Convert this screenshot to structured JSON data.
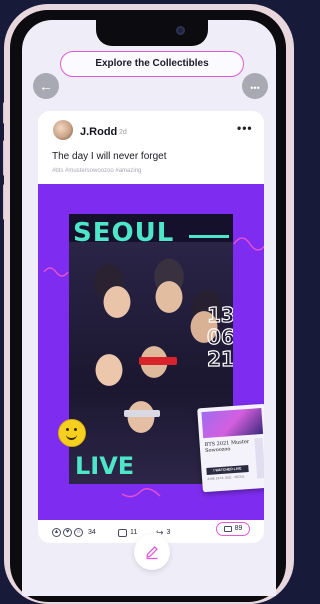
{
  "explore_button": {
    "label": "Explore the Collectibles"
  },
  "nav": {
    "back_icon": "arrow-left-icon",
    "more_icon": "more-horizontal-icon"
  },
  "post": {
    "author": "J.Rodd",
    "age": "2d",
    "menu": "•••",
    "caption": "The day I will never forget",
    "tags": "#bts #mustersowoozoo #amazing",
    "media": {
      "poster_headline": "SEOUL",
      "poster_footer": "LIVE",
      "poster_numbers": [
        "13",
        "06",
        "21"
      ],
      "ticket": {
        "title": "BTS 2021 Muster Sowoozoo",
        "badge": "I WATCHED LIVE",
        "subtitle": "JUNE 13-14, 2021 · SEOUL"
      }
    },
    "reactions": {
      "count": "34",
      "icons": [
        "thumbs-up-icon",
        "heart-icon",
        "fire-icon"
      ]
    },
    "comments": {
      "count": "11",
      "icon": "comment-icon"
    },
    "shares": {
      "count": "3",
      "icon": "share-icon"
    },
    "collect": {
      "count": "89",
      "icon": "collectible-icon"
    }
  },
  "fab": {
    "icon": "edit-pencil-icon"
  },
  "colors": {
    "accent": "#e05ad6",
    "media_bg": "#7e2df0",
    "poster_text": "#4de6c8",
    "background": "#181a3a"
  }
}
